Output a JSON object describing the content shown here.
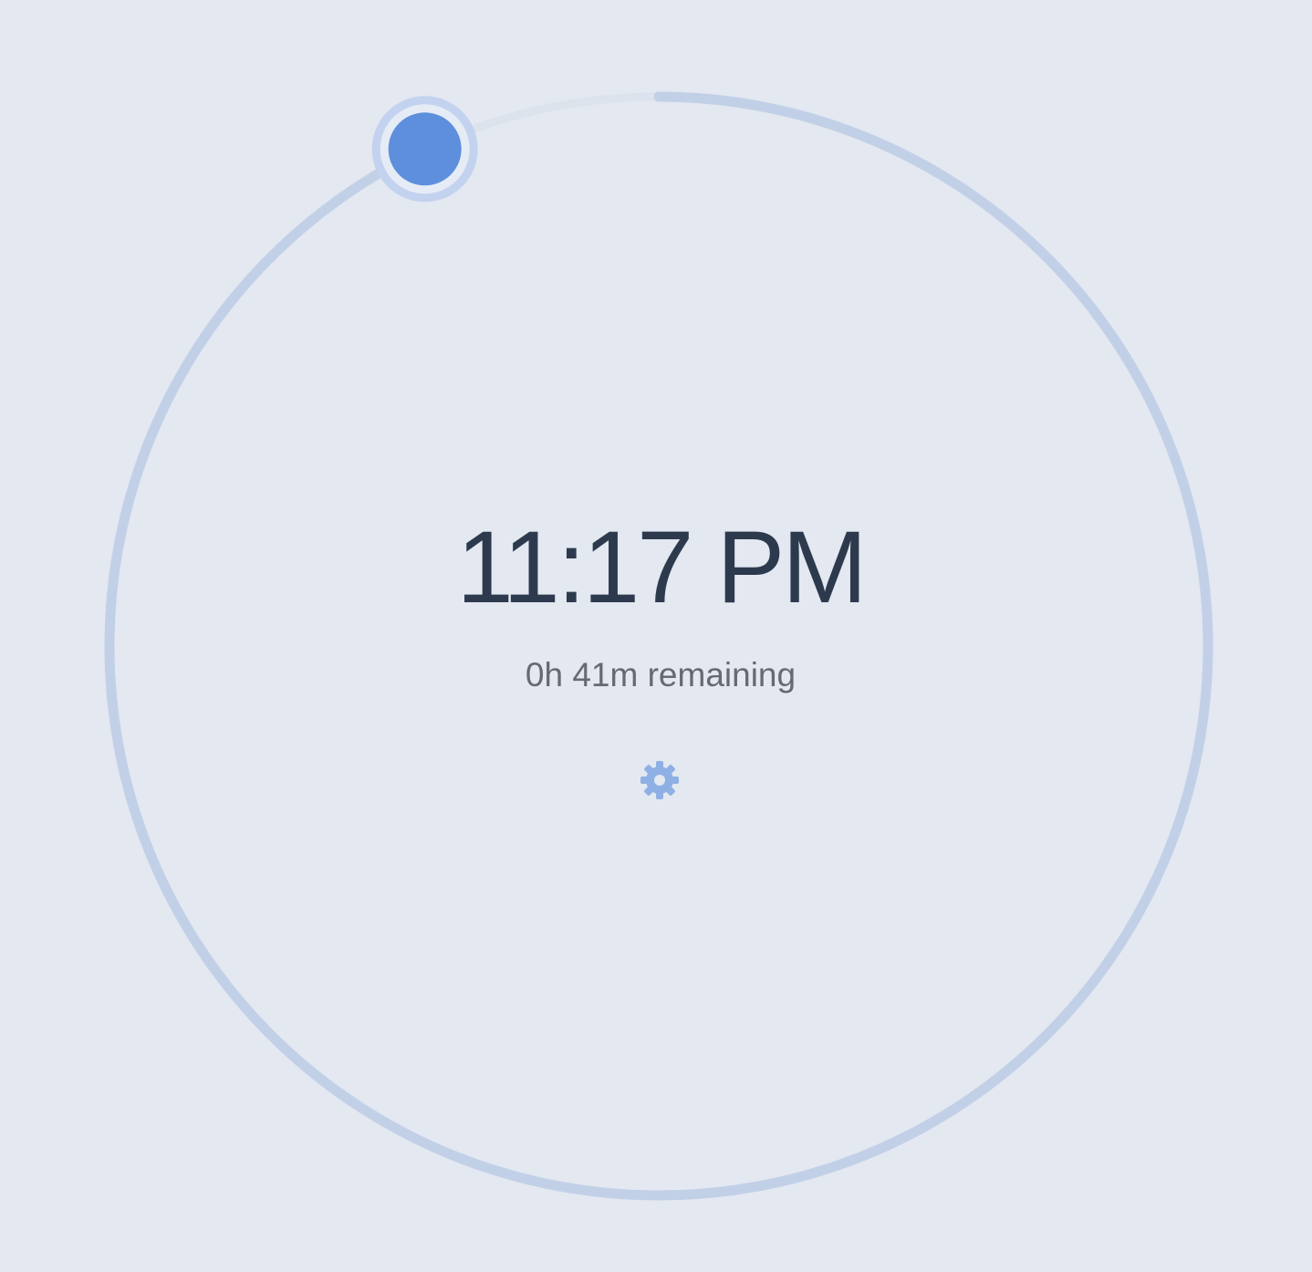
{
  "timer": {
    "time": "11:17 PM",
    "remaining": "0h 41m remaining",
    "progress_fraction": 0.93,
    "settings_icon": "gear-icon"
  },
  "colors": {
    "background": "#e3e8f1",
    "track": "#c2d0e7",
    "track_end_segment": "#dde3ec",
    "knob_fill": "#5e8fdd",
    "knob_halo": "#c3d2ee",
    "time_text": "#2d3a4e",
    "remaining_text": "#666a70",
    "gear": "#8fb0e5"
  }
}
